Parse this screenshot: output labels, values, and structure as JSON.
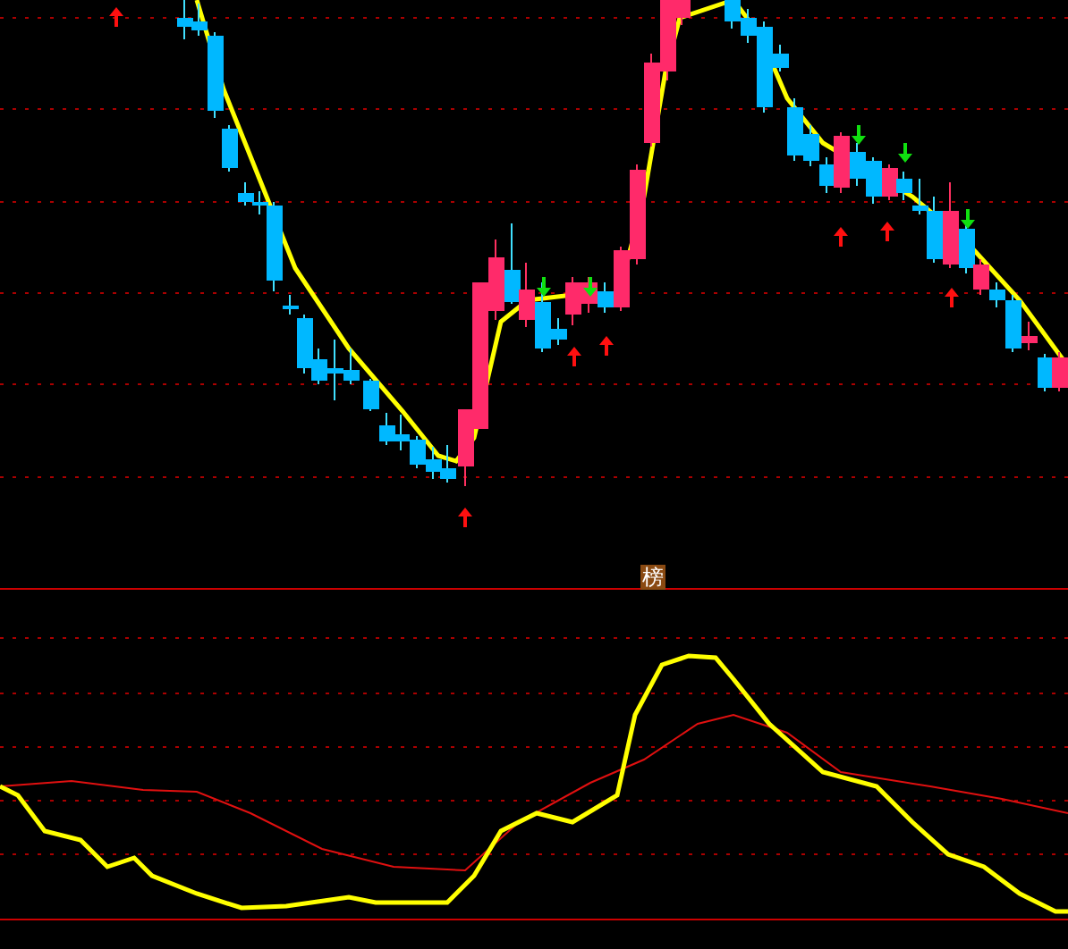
{
  "badge": {
    "label": "榜"
  }
}
